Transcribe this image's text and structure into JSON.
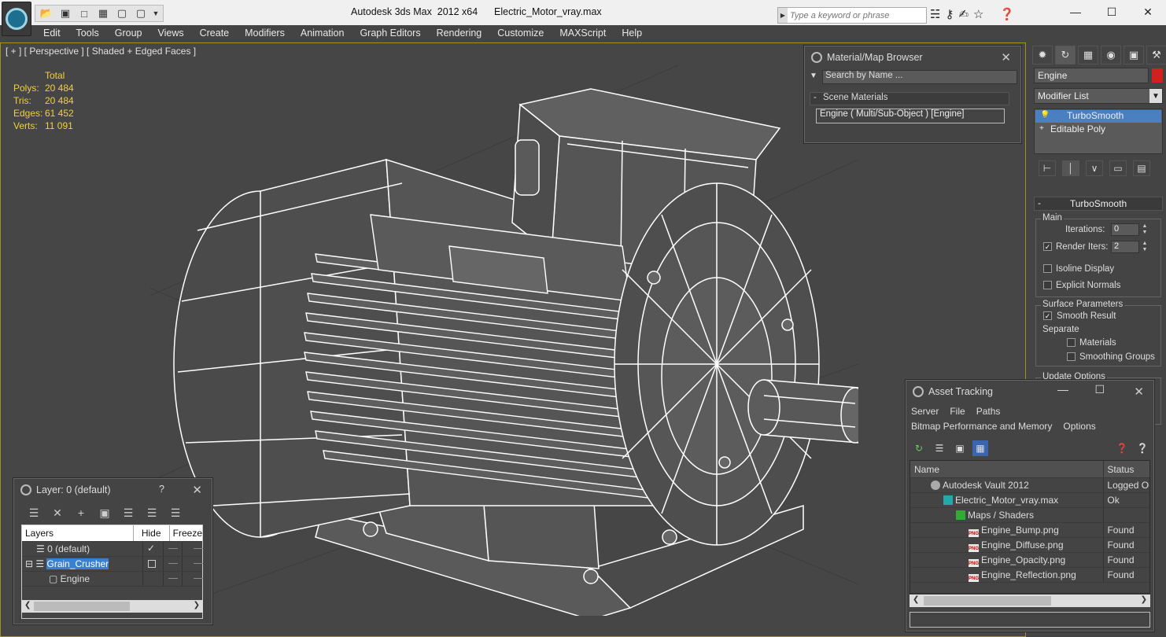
{
  "titlebar": {
    "title": "Autodesk 3ds Max  2012 x64      Electric_Motor_vray.max",
    "search_placeholder": "Type a keyword or phrase",
    "icons": [
      "binoculars-icon",
      "key-icon",
      "communication-icon",
      "star-icon",
      "help-icon"
    ]
  },
  "menu": [
    "Edit",
    "Tools",
    "Group",
    "Views",
    "Create",
    "Modifiers",
    "Animation",
    "Graph Editors",
    "Rendering",
    "Customize",
    "MAXScript",
    "Help"
  ],
  "viewport": {
    "label": "[ + ] [ Perspective ] [ Shaded + Edged Faces ]",
    "stats_header": "Total",
    "stats": [
      {
        "label": "Polys:",
        "value": "20 484"
      },
      {
        "label": "Tris:",
        "value": "20 484"
      },
      {
        "label": "Edges:",
        "value": "61 452"
      },
      {
        "label": "Verts:",
        "value": "11 091"
      }
    ]
  },
  "material_browser": {
    "title": "Material/Map Browser",
    "search_placeholder": "Search by Name ...",
    "section": "Scene Materials",
    "item": "Engine  ( Multi/Sub-Object )  [Engine]"
  },
  "command_panel": {
    "object_name": "Engine",
    "object_color": "#d02020",
    "modifier_list": "Modifier List",
    "stack": [
      "TurboSmooth",
      "Editable Poly"
    ],
    "rollout_title": "TurboSmooth",
    "main_label": "Main",
    "iterations_label": "Iterations:",
    "iterations_value": "0",
    "render_iters_label": "Render Iters:",
    "render_iters_value": "2",
    "isoline_label": "Isoline Display",
    "explicit_normals_label": "Explicit Normals",
    "surface_params_label": "Surface Parameters",
    "smooth_result_label": "Smooth Result",
    "separate_label": "Separate",
    "materials_label": "Materials",
    "smoothing_groups_label": "Smoothing Groups",
    "update_options_label": "Update Options"
  },
  "asset_tracking": {
    "title": "Asset Tracking",
    "menu1": [
      "Server",
      "File",
      "Paths"
    ],
    "menu2": [
      "Bitmap Performance and Memory",
      "Options"
    ],
    "col_name": "Name",
    "col_status": "Status",
    "rows": [
      {
        "name": "Autodesk Vault 2012",
        "status": "Logged Out",
        "indent": 1,
        "icon": "vault-icon"
      },
      {
        "name": "Electric_Motor_vray.max",
        "status": "Ok",
        "indent": 2,
        "icon": "max-file-icon"
      },
      {
        "name": "Maps / Shaders",
        "status": "",
        "indent": 3,
        "icon": "maps-icon"
      },
      {
        "name": "Engine_Bump.png",
        "status": "Found",
        "indent": 4,
        "icon": "png-icon"
      },
      {
        "name": "Engine_Diffuse.png",
        "status": "Found",
        "indent": 4,
        "icon": "png-icon"
      },
      {
        "name": "Engine_Opacity.png",
        "status": "Found",
        "indent": 4,
        "icon": "png-icon"
      },
      {
        "name": "Engine_Reflection.png",
        "status": "Found",
        "indent": 4,
        "icon": "png-icon"
      }
    ]
  },
  "layer_window": {
    "title": "Layer: 0 (default)",
    "help": "?",
    "col_layers": "Layers",
    "col_hide": "Hide",
    "col_freeze": "Freeze",
    "rows": [
      {
        "name": "0 (default)",
        "indent": 1
      },
      {
        "name": "Grain_Crusher",
        "indent": 1
      },
      {
        "name": "Engine",
        "indent": 2
      }
    ]
  }
}
